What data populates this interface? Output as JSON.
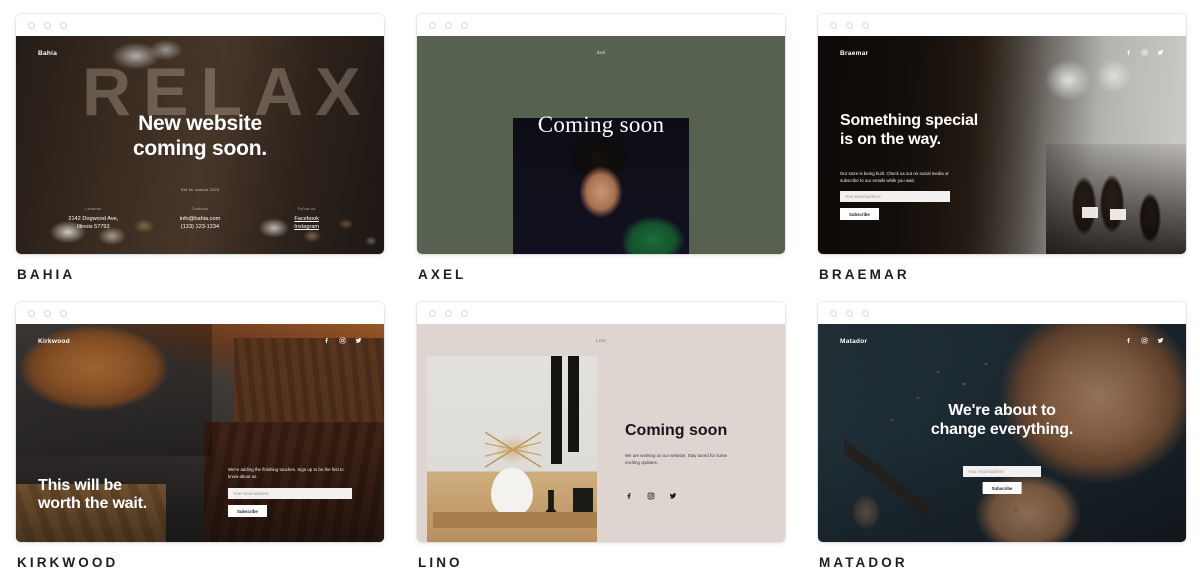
{
  "gallery": {
    "templates": [
      {
        "name": "BAHIA",
        "brand": "Bahia",
        "bg_word": "RELAX",
        "headline_line1": "New website",
        "headline_line2": "coming soon.",
        "launch_note": "Set for launch 2020",
        "columns": [
          {
            "label": "Location",
            "value_line1": "2142 Dogwood Ave,",
            "value_line2": "Illinois 57793"
          },
          {
            "label": "Contacts",
            "value_line1": "info@bahia.com",
            "value_line2": "(123) 123-1234"
          },
          {
            "label": "Follow us",
            "value_line1": "Facebook",
            "value_line2": "Instagram"
          }
        ]
      },
      {
        "name": "AXEL",
        "brand": "Axel",
        "headline": "Coming soon"
      },
      {
        "name": "BRAEMAR",
        "brand": "Braemar",
        "headline_line1": "Something special",
        "headline_line2": "is on the way.",
        "body": "Our store is being built. Check us out on social media or subscribe to our emails while you wait.",
        "email_placeholder": "Your email address",
        "subscribe_label": "Subscribe",
        "socials": [
          "facebook-icon",
          "instagram-icon",
          "twitter-icon"
        ]
      },
      {
        "name": "KIRKWOOD",
        "brand": "Kirkwood",
        "headline_line1": "This will be",
        "headline_line2": "worth the wait.",
        "body": "We're adding the finishing touches. Sign up to be the first to know about us.",
        "email_placeholder": "Your email address",
        "subscribe_label": "Subscribe",
        "socials": [
          "facebook-icon",
          "instagram-icon",
          "twitter-icon"
        ]
      },
      {
        "name": "LINO",
        "brand": "Lino",
        "headline": "Coming soon",
        "body": "We are working on our website. Stay tuned for some exciting updates.",
        "socials": [
          "facebook-icon",
          "instagram-icon",
          "twitter-icon"
        ]
      },
      {
        "name": "MATADOR",
        "brand": "Matador",
        "headline_line1": "We're about to",
        "headline_line2": "change everything.",
        "email_placeholder": "Your email address",
        "subscribe_label": "Subscribe",
        "socials": [
          "facebook-icon",
          "instagram-icon",
          "twitter-icon"
        ]
      }
    ]
  },
  "colors": {
    "page_bg": "#ffffff",
    "label_text": "#1e1e1e",
    "axel_bg": "#56614f",
    "lino_bg": "#ded5d0",
    "chrome_bg": "#ffffff",
    "dot_border": "#d7d7d7"
  }
}
